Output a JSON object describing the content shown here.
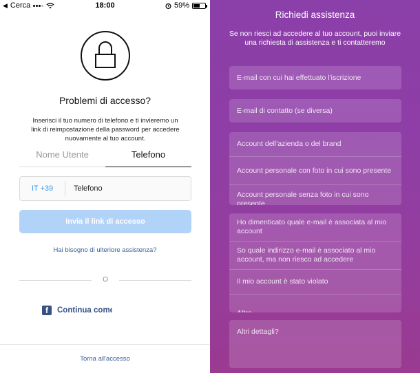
{
  "status_bar": {
    "carrier": "Cerca",
    "time": "18:00",
    "battery_percent": "59%",
    "battery_level": 0.59
  },
  "left": {
    "title": "Problemi di accesso?",
    "description": "Inserisci il tuo numero di telefono e ti invieremo un link di reimpostazione della password per accedere nuovamente al tuo account.",
    "tabs": [
      {
        "label": "Nome Utente",
        "active": false
      },
      {
        "label": "Telefono",
        "active": true
      }
    ],
    "country_code": "IT +39",
    "phone_placeholder": "Telefono",
    "send_button": "Invia il link di accesso",
    "help_link": "Hai bisogno di ulteriore assistenza?",
    "divider_text": "O",
    "facebook_button": "Continua come",
    "footer_link": "Torna all'accesso"
  },
  "right": {
    "title": "Richiedi assistenza",
    "description": "Se non riesci ad accedere al tuo account, puoi inviare una richiesta di assistenza e ti contatteremo",
    "signup_email_placeholder": "E-mail con cui hai effettuato l'iscrizione",
    "contact_email_placeholder": "E-mail di contatto (se diversa)",
    "account_types": [
      "Account dell'azienda o del brand",
      "Account personale con foto in cui sono presente",
      "Account personale senza foto in cui sono presente"
    ],
    "issues": [
      "Ho dimenticato quale e-mail è associata al mio account",
      "So quale indirizzo e-mail è associato al mio account, ma non riesco ad accedere",
      "Il mio account è stato violato",
      "Altro"
    ],
    "details_placeholder": "Altri dettagli?"
  },
  "colors": {
    "accent_blue": "#3897f0",
    "link_blue": "#3b5f97",
    "facebook_blue": "#385185",
    "purple_gradient_top": "#8b3fa8",
    "purple_gradient_bottom": "#9a3a90"
  }
}
